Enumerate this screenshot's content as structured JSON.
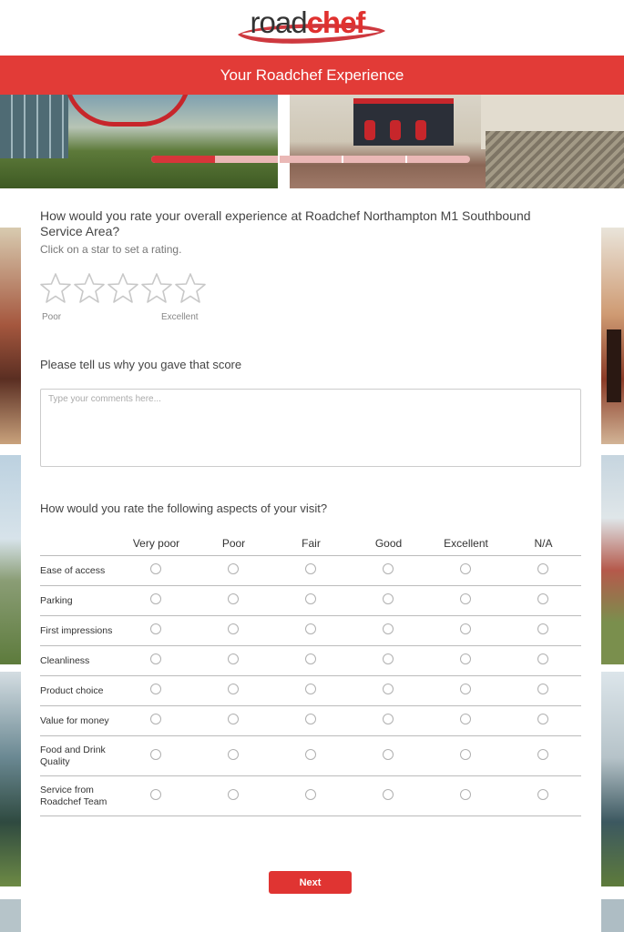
{
  "brand": {
    "road": "road",
    "chef": "chef"
  },
  "header": {
    "title": "Your Roadchef Experience"
  },
  "progress": {
    "fraction": 0.2
  },
  "question1": {
    "text": "How would you rate your overall experience at Roadchef Northampton M1 Southbound Service Area?",
    "hint": "Click on a star to set a rating.",
    "star_count": 5,
    "low_label": "Poor",
    "high_label": "Excellent"
  },
  "question2": {
    "text": "Please tell us why you gave that score",
    "placeholder": "Type your comments here..."
  },
  "question3": {
    "text": "How would you rate the following aspects of your visit?",
    "columns": [
      "Very poor",
      "Poor",
      "Fair",
      "Good",
      "Excellent",
      "N/A"
    ],
    "rows": [
      "Ease of access",
      "Parking",
      "First impressions",
      "Cleanliness",
      "Product choice",
      "Value for money",
      "Food and Drink Quality",
      "Service from Roadchef Team"
    ]
  },
  "buttons": {
    "next": "Next"
  },
  "colors": {
    "accent": "#e23b37",
    "progress_fill": "#d7353a",
    "progress_track": "#eab8b6"
  }
}
